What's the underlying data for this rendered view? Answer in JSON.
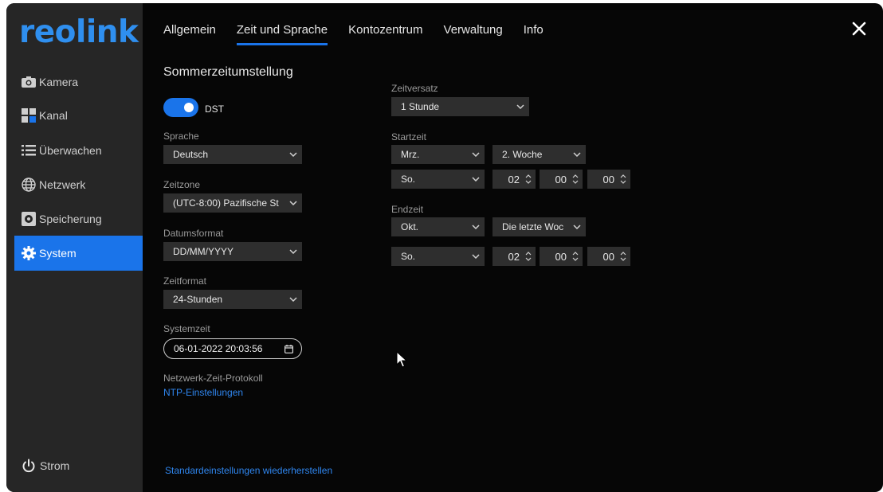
{
  "brand": {
    "logo_text": "reolink",
    "accent": "#1a74ea",
    "link_color": "#2f86ef"
  },
  "sidebar": {
    "items": [
      {
        "label": "Kamera",
        "icon": "camera-icon"
      },
      {
        "label": "Kanal",
        "icon": "grid-icon"
      },
      {
        "label": "Überwachen",
        "icon": "list-icon"
      },
      {
        "label": "Netzwerk",
        "icon": "globe-icon"
      },
      {
        "label": "Speicherung",
        "icon": "storage-icon"
      },
      {
        "label": "System",
        "icon": "gear-icon",
        "active": true
      }
    ],
    "power_label": "Strom"
  },
  "tabs": [
    {
      "label": "Allgemein"
    },
    {
      "label": "Zeit und Sprache",
      "active": true
    },
    {
      "label": "Kontozentrum"
    },
    {
      "label": "Verwaltung"
    },
    {
      "label": "Info"
    }
  ],
  "dst": {
    "heading": "Sommerzeitumstellung",
    "toggle_label": "DST",
    "enabled": true
  },
  "language": {
    "label": "Sprache",
    "value": "Deutsch"
  },
  "timezone": {
    "label": "Zeitzone",
    "value": "(UTC-8:00) Pazifische St"
  },
  "date_format": {
    "label": "Datumsformat",
    "value": "DD/MM/YYYY"
  },
  "time_format": {
    "label": "Zeitformat",
    "value": "24-Stunden"
  },
  "system_time": {
    "label": "Systemzeit",
    "value": "06-01-2022 20:03:56"
  },
  "ntp": {
    "label": "Netzwerk-Zeit-Protokoll",
    "link": "NTP-Einstellungen"
  },
  "offset": {
    "label": "Zeitversatz",
    "value": "1 Stunde"
  },
  "start": {
    "label": "Startzeit",
    "month": "Mrz.",
    "week": "2. Woche",
    "day": "So.",
    "hour": "02",
    "minute": "00",
    "second": "00"
  },
  "end": {
    "label": "Endzeit",
    "month": "Okt.",
    "week": "Die letzte Woc",
    "day": "So.",
    "hour": "02",
    "minute": "00",
    "second": "00"
  },
  "restore_link": "Standardeinstellungen wiederherstellen"
}
